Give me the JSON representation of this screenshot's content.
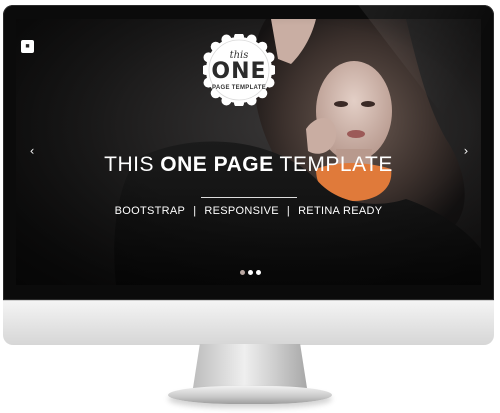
{
  "hero": {
    "badge": {
      "small": "this",
      "big": "ONE",
      "sub": "PAGE TEMPLATE"
    },
    "title_light_1": "THIS ",
    "title_bold": "ONE PAGE",
    "title_light_2": " TEMPLATE",
    "tags": [
      "BOOTSTRAP",
      "RESPONSIVE",
      "RETINA READY"
    ],
    "tag_separator": "|",
    "arrows": {
      "prev": "‹",
      "next": "›"
    },
    "slides": {
      "count": 3,
      "active": 1
    }
  },
  "icons": {
    "menu": "menu-icon",
    "prev": "chevron-left-icon",
    "next": "chevron-right-icon"
  },
  "colors": {
    "background": "#1a1a1a",
    "text": "#ffffff",
    "badge": "#ffffff",
    "scarf_accent": "#e07a3a"
  }
}
